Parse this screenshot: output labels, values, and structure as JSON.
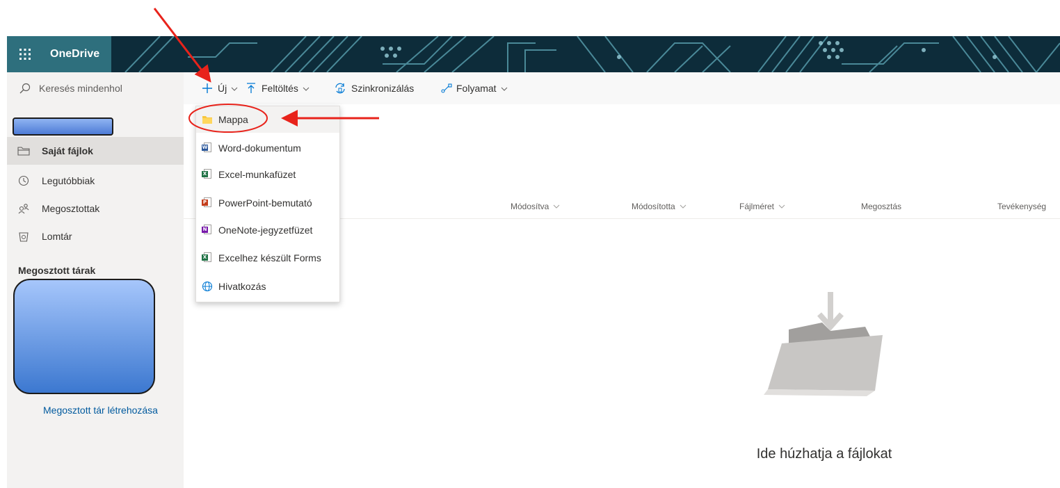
{
  "header": {
    "app_title": "OneDrive",
    "waffle_icon": "app-launcher-icon"
  },
  "search": {
    "label": "Keresés mindenhol",
    "icon": "search-icon"
  },
  "nav": {
    "items": [
      {
        "label": "Saját fájlok",
        "icon": "folder-icon",
        "selected": true
      },
      {
        "label": "Legutóbbiak",
        "icon": "recent-clock-icon",
        "selected": false
      },
      {
        "label": "Megosztottak",
        "icon": "people-icon",
        "selected": false
      },
      {
        "label": "Lomtár",
        "icon": "recycle-bin-icon",
        "selected": false
      }
    ],
    "shared_libraries_heading": "Megosztott tárak",
    "create_shared_library": "Megosztott tár létrehozása"
  },
  "command_bar": {
    "new": "Új",
    "upload": "Feltöltés",
    "sync": "Szinkronizálás",
    "flow": "Folyamat"
  },
  "columns": {
    "modified": "Módosítva",
    "modified_by": "Módosította",
    "file_size": "Fájlméret",
    "sharing": "Megosztás",
    "activity": "Tevékenység"
  },
  "new_menu": {
    "items": [
      {
        "label": "Mappa",
        "icon": "folder-icon"
      },
      {
        "label": "Word-dokumentum",
        "icon": "word-icon"
      },
      {
        "label": "Excel-munkafüzet",
        "icon": "excel-icon"
      },
      {
        "label": "PowerPoint-bemutató",
        "icon": "powerpoint-icon"
      },
      {
        "label": "OneNote-jegyzetfüzet",
        "icon": "onenote-icon"
      },
      {
        "label": "Excelhez készült Forms",
        "icon": "excel-forms-icon"
      },
      {
        "label": "Hivatkozás",
        "icon": "globe-link-icon"
      }
    ]
  },
  "empty_state": {
    "text": "Ide húzhatja a fájlokat"
  },
  "colors": {
    "header_bg": "#0d2c3a",
    "nav_bg": "#f3f2f1",
    "accent_blue": "#0078d4",
    "annotation_red": "#e8231b",
    "word": "#2b579a",
    "excel": "#217346",
    "powerpoint": "#c43e1c",
    "onenote": "#7719aa"
  }
}
